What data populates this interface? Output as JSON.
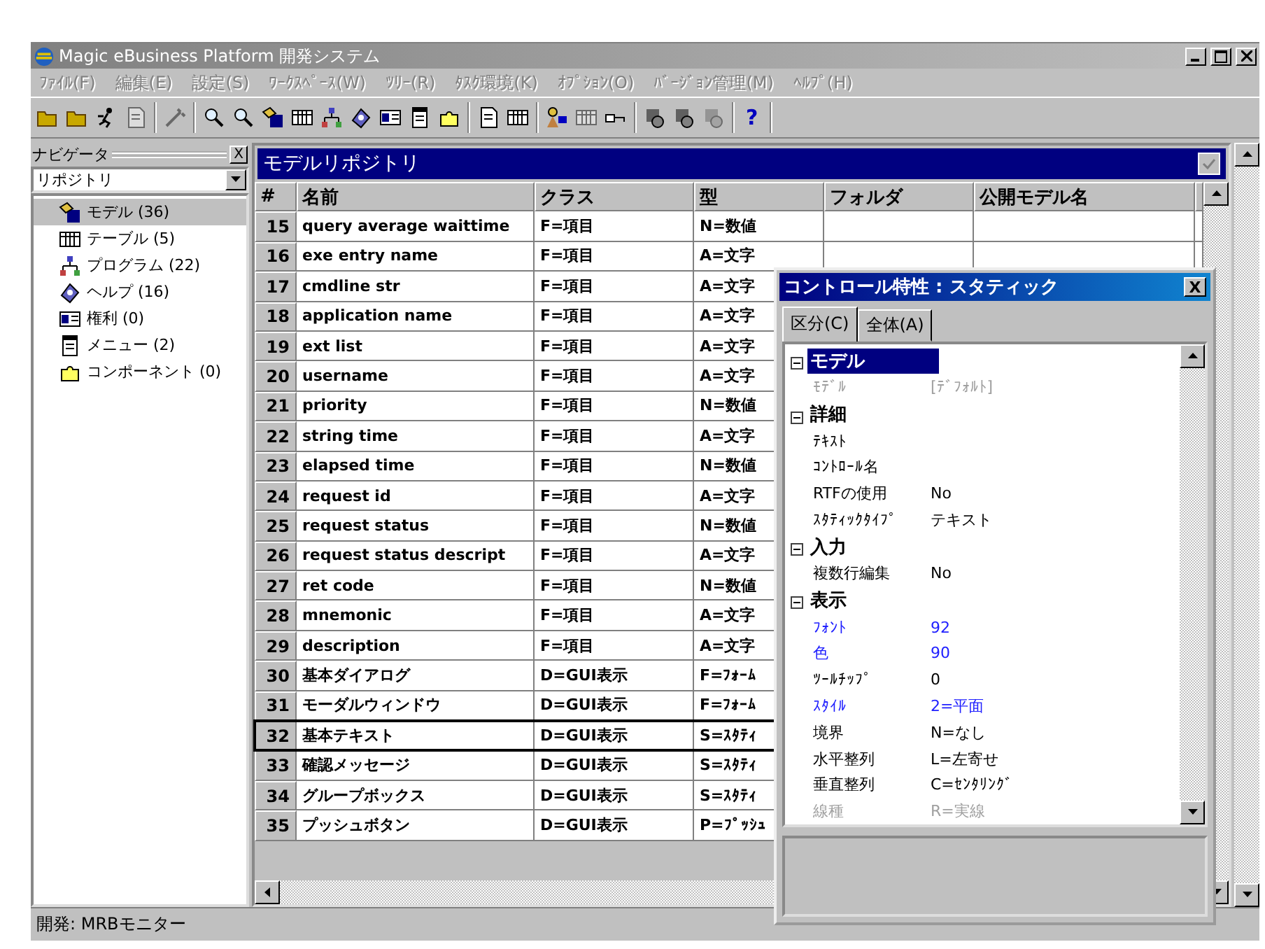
{
  "window": {
    "title": "Magic eBusiness Platform 開発システム",
    "active": false
  },
  "menu": [
    {
      "label": "ﾌｧｲﾙ(F)",
      "disabled": true
    },
    {
      "label": "編集(E)",
      "disabled": true
    },
    {
      "label": "設定(S)",
      "disabled": true
    },
    {
      "label": "ﾜｰｸｽﾍﾟｰｽ(W)",
      "disabled": true
    },
    {
      "label": "ﾂﾘｰ(R)",
      "disabled": true
    },
    {
      "label": "ﾀｽｸ環境(K)",
      "disabled": true
    },
    {
      "label": "ｵﾌﾟｼｮﾝ(O)",
      "disabled": true
    },
    {
      "label": "ﾊﾞｰｼﾞｮﾝ管理(M)",
      "disabled": true
    },
    {
      "label": "ﾍﾙﾌﾟ(H)",
      "disabled": true
    }
  ],
  "toolbar": {
    "help_label": "?"
  },
  "navigator": {
    "title": "ナビゲータ",
    "close": "X",
    "dropdown": "リポジトリ",
    "items": [
      {
        "label": "モデル (36)",
        "selected": true
      },
      {
        "label": "テーブル (5)",
        "selected": false
      },
      {
        "label": "プログラム (22)",
        "selected": false
      },
      {
        "label": "ヘルプ (16)",
        "selected": false
      },
      {
        "label": "権利 (0)",
        "selected": false
      },
      {
        "label": "メニュー (2)",
        "selected": false
      },
      {
        "label": "コンポーネント (0)",
        "selected": false
      }
    ]
  },
  "repository": {
    "title": "モデルリポジトリ",
    "columns": [
      "#",
      "名前",
      "クラス",
      "型",
      "フォルダ",
      "公開モデル名"
    ],
    "rows": [
      {
        "num": "15",
        "name": "query average waittime",
        "class": "F=項目",
        "type": "N=数値",
        "selected": false
      },
      {
        "num": "16",
        "name": "exe entry name",
        "class": "F=項目",
        "type": "A=文字",
        "selected": false
      },
      {
        "num": "17",
        "name": "cmdline str",
        "class": "F=項目",
        "type": "A=文字",
        "selected": false
      },
      {
        "num": "18",
        "name": "application name",
        "class": "F=項目",
        "type": "A=文字",
        "selected": false
      },
      {
        "num": "19",
        "name": "ext list",
        "class": "F=項目",
        "type": "A=文字",
        "selected": false
      },
      {
        "num": "20",
        "name": "username",
        "class": "F=項目",
        "type": "A=文字",
        "selected": false
      },
      {
        "num": "21",
        "name": "priority",
        "class": "F=項目",
        "type": "N=数値",
        "selected": false
      },
      {
        "num": "22",
        "name": "string time",
        "class": "F=項目",
        "type": "A=文字",
        "selected": false
      },
      {
        "num": "23",
        "name": "elapsed time",
        "class": "F=項目",
        "type": "N=数値",
        "selected": false
      },
      {
        "num": "24",
        "name": "request id",
        "class": "F=項目",
        "type": "A=文字",
        "selected": false
      },
      {
        "num": "25",
        "name": "request status",
        "class": "F=項目",
        "type": "N=数値",
        "selected": false
      },
      {
        "num": "26",
        "name": "request status descript",
        "class": "F=項目",
        "type": "A=文字",
        "selected": false
      },
      {
        "num": "27",
        "name": "ret code",
        "class": "F=項目",
        "type": "N=数値",
        "selected": false
      },
      {
        "num": "28",
        "name": "mnemonic",
        "class": "F=項目",
        "type": "A=文字",
        "selected": false
      },
      {
        "num": "29",
        "name": "description",
        "class": "F=項目",
        "type": "A=文字",
        "selected": false
      },
      {
        "num": "30",
        "name": "基本ダイアログ",
        "class": "D=GUI表示",
        "type": "F=ﾌｫｰﾑ",
        "selected": false
      },
      {
        "num": "31",
        "name": "モーダルウィンドウ",
        "class": "D=GUI表示",
        "type": "F=ﾌｫｰﾑ",
        "selected": false
      },
      {
        "num": "32",
        "name": "基本テキスト",
        "class": "D=GUI表示",
        "type": "S=ｽﾀﾃｨ",
        "selected": true
      },
      {
        "num": "33",
        "name": "確認メッセージ",
        "class": "D=GUI表示",
        "type": "S=ｽﾀﾃｨ",
        "selected": false
      },
      {
        "num": "34",
        "name": "グループボックス",
        "class": "D=GUI表示",
        "type": "S=ｽﾀﾃｨ",
        "selected": false
      },
      {
        "num": "35",
        "name": "プッシュボタン",
        "class": "D=GUI表示",
        "type": "P=ﾌﾟｯｼｭ",
        "selected": false
      }
    ]
  },
  "properties": {
    "title": "コントロール特性 : スタティック",
    "close": "X",
    "tabs": [
      {
        "label": "区分(C)",
        "selected": true
      },
      {
        "label": "全体(A)",
        "selected": false
      }
    ],
    "items": [
      {
        "kind": "group",
        "label": "モデル",
        "selected": true
      },
      {
        "kind": "prop",
        "label": "ﾓﾃﾞﾙ",
        "value": "[ﾃﾞﾌｫﾙﾄ]",
        "disabled": true,
        "modified": false
      },
      {
        "kind": "group",
        "label": "詳細",
        "selected": false
      },
      {
        "kind": "prop",
        "label": "ﾃｷｽﾄ",
        "disabled": false,
        "modified": false
      },
      {
        "kind": "prop",
        "label": "ｺﾝﾄﾛｰﾙ名",
        "disabled": false,
        "modified": false
      },
      {
        "kind": "prop",
        "label": "RTFの使用",
        "value": "No",
        "disabled": false,
        "modified": false
      },
      {
        "kind": "prop",
        "label": "ｽﾀﾃｨｯｸﾀｲﾌﾟ",
        "value": "テキスト",
        "disabled": false,
        "modified": false
      },
      {
        "kind": "group",
        "label": "入力",
        "selected": false
      },
      {
        "kind": "prop",
        "label": "複数行編集",
        "value": "No",
        "disabled": false,
        "modified": false
      },
      {
        "kind": "group",
        "label": "表示",
        "selected": false
      },
      {
        "kind": "prop",
        "label": "ﾌｫﾝﾄ",
        "value": "92",
        "disabled": false,
        "modified": true
      },
      {
        "kind": "prop",
        "label": "色",
        "value": "90",
        "disabled": false,
        "modified": true
      },
      {
        "kind": "prop",
        "label": "ﾂｰﾙﾁｯﾌﾟ",
        "value": "0",
        "disabled": false,
        "modified": false
      },
      {
        "kind": "prop",
        "label": "ｽﾀｲﾙ",
        "value": "2=平面",
        "disabled": false,
        "modified": true
      },
      {
        "kind": "prop",
        "label": "境界",
        "value": "N=なし",
        "disabled": false,
        "modified": false
      },
      {
        "kind": "prop",
        "label": "水平整列",
        "value": "L=左寄せ",
        "disabled": false,
        "modified": false
      },
      {
        "kind": "prop",
        "label": "垂直整列",
        "value": "C=ｾﾝﾀﾘﾝｸﾞ",
        "disabled": false,
        "modified": false
      },
      {
        "kind": "prop",
        "label": "線種",
        "value": "R=実線",
        "disabled": true,
        "modified": false
      }
    ]
  },
  "status_bar": {
    "text": "開発: MRBモニター"
  }
}
